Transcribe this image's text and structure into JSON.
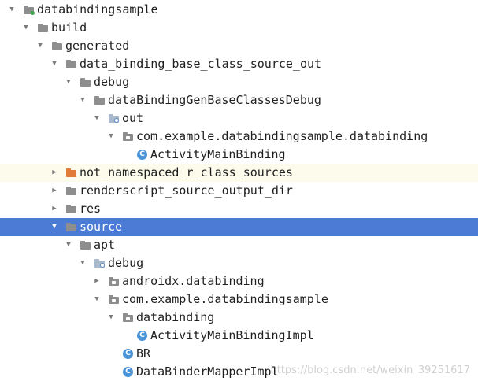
{
  "tree": {
    "module": "databindingsample",
    "build": "build",
    "generated": "generated",
    "data_binding_base_class_source_out": "data_binding_base_class_source_out",
    "debug_1": "debug",
    "gen_base_classes_debug": "dataBindingGenBaseClassesDebug",
    "out": "out",
    "pkg_databinding_1": "com.example.databindingsample.databinding",
    "activity_main_binding": "ActivityMainBinding",
    "not_namespaced": "not_namespaced_r_class_sources",
    "renderscript": "renderscript_source_output_dir",
    "res": "res",
    "source": "source",
    "apt": "apt",
    "debug_2": "debug",
    "androidx_databinding": "androidx.databinding",
    "pkg_app": "com.example.databindingsample",
    "databinding": "databinding",
    "activity_main_binding_impl": "ActivityMainBindingImpl",
    "br": "BR",
    "data_binder_mapper_impl": "DataBinderMapperImpl"
  },
  "watermark": "https://blog.csdn.net/weixin_39251617",
  "colors": {
    "selection": "#4c7bd6",
    "highlight_row": "#fcfbec",
    "folder": "#8e8e8e",
    "excluded_folder": "#e07b39",
    "class_icon": "#4a94d9"
  }
}
